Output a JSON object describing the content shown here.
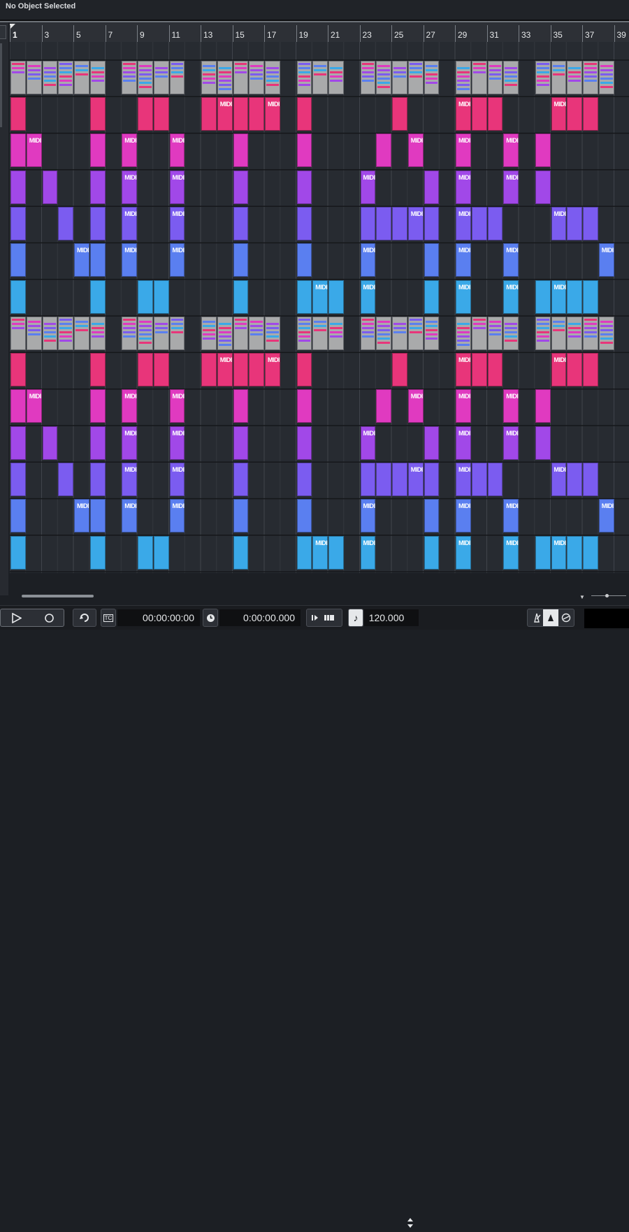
{
  "info_bar": {
    "title": "No Object Selected"
  },
  "ruler": {
    "bars": [
      "1",
      "3",
      "5",
      "7",
      "9",
      "11",
      "13",
      "15",
      "17",
      "19",
      "21",
      "23",
      "25",
      "27",
      "29",
      "31",
      "33",
      "35",
      "37",
      "39"
    ]
  },
  "part_label": "MIDI",
  "transport": {
    "timecode_label": "TC",
    "primary_time": "00:00:00:00",
    "secondary_time": "0:00:00.000",
    "tempo": "120.000"
  },
  "colors": {
    "pink": "#e8357a",
    "magenta": "#e03ac0",
    "violet": "#a148e8",
    "indigo": "#7b5cf0",
    "blue": "#5a7ff0",
    "cyan": "#3aa9e8",
    "header_part": "#a9aaab"
  },
  "icons": [
    "play-icon",
    "record-icon",
    "cycle-icon",
    "timecode-icon",
    "clock-icon",
    "step-icon",
    "tempo-note-icon",
    "tempo-spinner-icon",
    "metronome-icon",
    "precount-icon",
    "sync-icon"
  ]
}
